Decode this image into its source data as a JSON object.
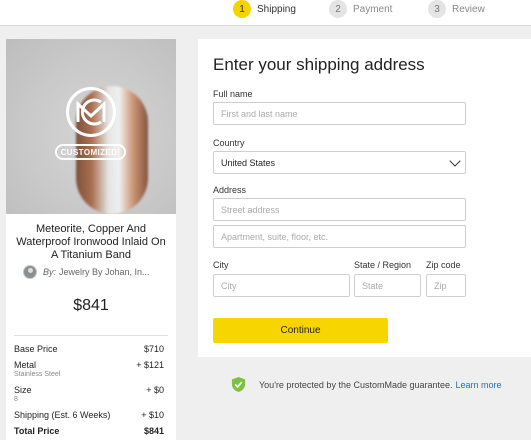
{
  "steps": [
    {
      "num": "1",
      "label": "Shipping"
    },
    {
      "num": "2",
      "label": "Payment"
    },
    {
      "num": "3",
      "label": "Review"
    }
  ],
  "product": {
    "badge": "CUSTOMIZED!",
    "title": "Meteorite, Copper And Waterproof Ironwood Inlaid On A Titanium Band",
    "by_label": "By:",
    "maker": "Jewelry By Johan, In...",
    "price": "$841",
    "lines": [
      {
        "label": "Base Price",
        "sub": "",
        "value": "$710"
      },
      {
        "label": "Metal",
        "sub": "Stainless Steel",
        "value": "+ $121"
      },
      {
        "label": "Size",
        "sub": "8",
        "value": "+ $0"
      },
      {
        "label": "Shipping (Est. 6 Weeks)",
        "sub": "",
        "value": "+ $10"
      },
      {
        "label": "Total Price",
        "sub": "",
        "value": "$841"
      }
    ]
  },
  "form": {
    "title": "Enter your shipping address",
    "full_name_label": "Full name",
    "full_name_placeholder": "First and last name",
    "country_label": "Country",
    "country_value": "United States",
    "address_label": "Address",
    "street_placeholder": "Street address",
    "apt_placeholder": "Apartment, suite, floor, etc.",
    "city_label": "City",
    "city_placeholder": "City",
    "state_label": "State / Region",
    "state_placeholder": "State",
    "zip_label": "Zip code",
    "zip_placeholder": "Zip",
    "continue_label": "Continue"
  },
  "guarantee": {
    "text": "You're protected by the CustomMade guarantee.",
    "link": "Learn more"
  },
  "colors": {
    "accent": "#f7d500",
    "link": "#2a6db5",
    "shield": "#7cc242"
  }
}
